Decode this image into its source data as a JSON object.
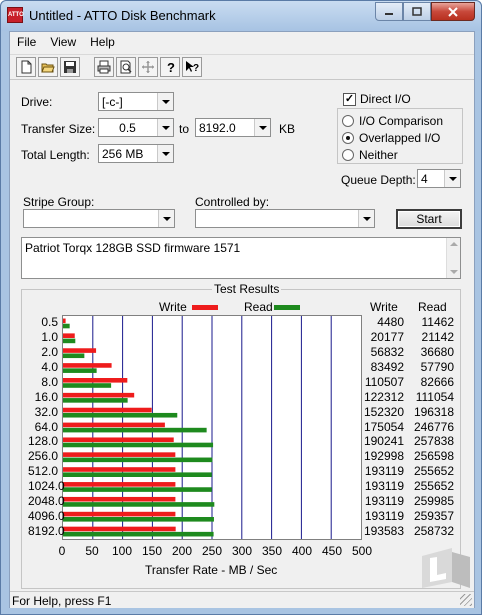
{
  "window": {
    "title": "Untitled - ATTO Disk Benchmark",
    "icon_text": "ATTO"
  },
  "menu": [
    "File",
    "View",
    "Help"
  ],
  "toolbar": [
    "new-icon",
    "open-icon",
    "save-icon",
    "print-icon",
    "print-preview-icon",
    "move-icon",
    "help-icon",
    "context-help-icon"
  ],
  "form": {
    "drive_label": "Drive:",
    "drive_value": "[-c-]",
    "transfer_size_label": "Transfer Size:",
    "transfer_from": "0.5",
    "to_label": "to",
    "transfer_to": "8192.0",
    "kb_label": "KB",
    "total_length_label": "Total Length:",
    "total_length_value": "256 MB",
    "direct_io_label": "Direct I/O",
    "direct_io_checked": true,
    "io_comparison_label": "I/O Comparison",
    "overlapped_io_label": "Overlapped I/O",
    "neither_label": "Neither",
    "queue_depth_label": "Queue Depth:",
    "queue_depth_value": "4",
    "stripe_group_label": "Stripe Group:",
    "stripe_group_value": "",
    "controlled_by_label": "Controlled by:",
    "controlled_by_value": "",
    "start_label": "Start",
    "description": "Patriot Torqx 128GB SSD firmware 1571"
  },
  "results": {
    "title": "Test Results",
    "legend_write": "Write",
    "legend_read": "Read",
    "col_write": "Write",
    "col_read": "Read",
    "write_color": "#ee1c1c",
    "read_color": "#1e8a1e",
    "xlabel": "Transfer Rate - MB / Sec"
  },
  "chart_data": {
    "type": "bar",
    "orientation": "horizontal",
    "categories": [
      "0.5",
      "1.0",
      "2.0",
      "4.0",
      "8.0",
      "16.0",
      "32.0",
      "64.0",
      "128.0",
      "256.0",
      "512.0",
      "1024.0",
      "2048.0",
      "4096.0",
      "8192.0"
    ],
    "series": [
      {
        "name": "Write",
        "values": [
          4480,
          20177,
          56832,
          83492,
          110507,
          122312,
          152320,
          175054,
          190241,
          192998,
          193119,
          193119,
          193119,
          193119,
          193583
        ]
      },
      {
        "name": "Read",
        "values": [
          11462,
          21142,
          36680,
          57790,
          82666,
          111054,
          196318,
          246776,
          257838,
          256598,
          255652,
          255652,
          259985,
          259357,
          258732
        ]
      }
    ],
    "value_unit_in_table": "KB/s",
    "xticks": [
      "0",
      "50",
      "100",
      "150",
      "200",
      "250",
      "300",
      "350",
      "400",
      "450",
      "500"
    ],
    "xlim": [
      0,
      500
    ],
    "xlabel": "Transfer Rate - MB / Sec",
    "grid": true,
    "legend": "top"
  },
  "status": {
    "text": "For Help, press F1"
  }
}
